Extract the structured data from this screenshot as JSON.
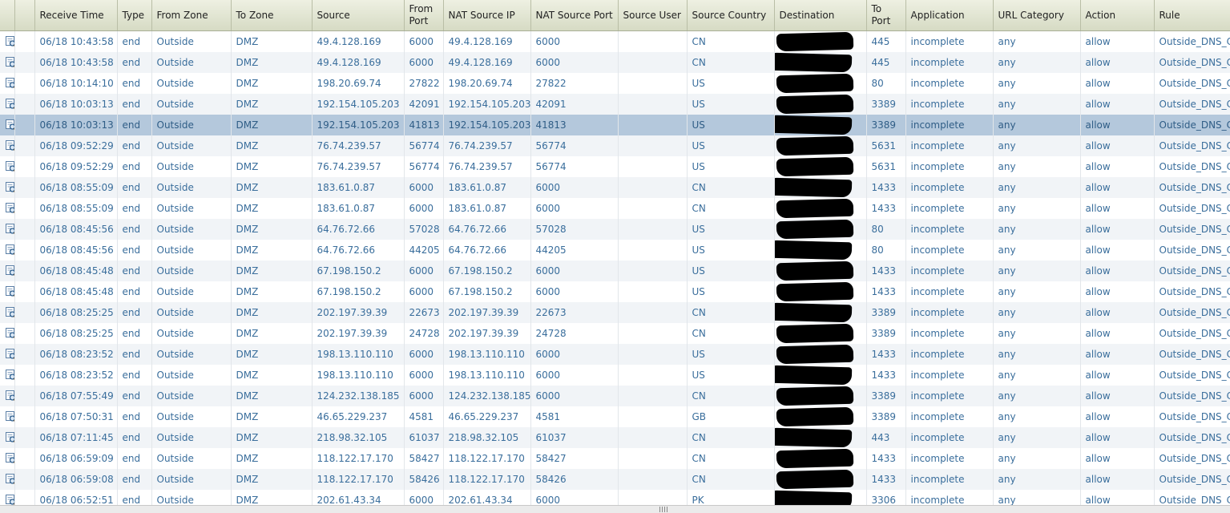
{
  "columns": [
    "",
    "",
    "Receive Time",
    "Type",
    "From Zone",
    "To Zone",
    "Source",
    "From Port",
    "NAT Source IP",
    "NAT Source Port",
    "Source User",
    "Source Country",
    "Destination",
    "To Port",
    "Application",
    "URL Category",
    "Action",
    "Rule"
  ],
  "rows": [
    {
      "time": "06/18 10:43:58",
      "type": "end",
      "from_zone": "Outside",
      "to_zone": "DMZ",
      "source": "49.4.128.169",
      "from_port": "6000",
      "nat_ip": "49.4.128.169",
      "nat_port": "6000",
      "user": "",
      "country": "CN",
      "to_port": "445",
      "app": "incomplete",
      "url": "any",
      "action": "allow",
      "rule": "Outside_DNS_C"
    },
    {
      "time": "06/18 10:43:58",
      "type": "end",
      "from_zone": "Outside",
      "to_zone": "DMZ",
      "source": "49.4.128.169",
      "from_port": "6000",
      "nat_ip": "49.4.128.169",
      "nat_port": "6000",
      "user": "",
      "country": "CN",
      "to_port": "445",
      "app": "incomplete",
      "url": "any",
      "action": "allow",
      "rule": "Outside_DNS_C"
    },
    {
      "time": "06/18 10:14:10",
      "type": "end",
      "from_zone": "Outside",
      "to_zone": "DMZ",
      "source": "198.20.69.74",
      "from_port": "27822",
      "nat_ip": "198.20.69.74",
      "nat_port": "27822",
      "user": "",
      "country": "US",
      "to_port": "80",
      "app": "incomplete",
      "url": "any",
      "action": "allow",
      "rule": "Outside_DNS_C"
    },
    {
      "time": "06/18 10:03:13",
      "type": "end",
      "from_zone": "Outside",
      "to_zone": "DMZ",
      "source": "192.154.105.203",
      "from_port": "42091",
      "nat_ip": "192.154.105.203",
      "nat_port": "42091",
      "user": "",
      "country": "US",
      "to_port": "3389",
      "app": "incomplete",
      "url": "any",
      "action": "allow",
      "rule": "Outside_DNS_C"
    },
    {
      "time": "06/18 10:03:13",
      "type": "end",
      "from_zone": "Outside",
      "to_zone": "DMZ",
      "source": "192.154.105.203",
      "from_port": "41813",
      "nat_ip": "192.154.105.203",
      "nat_port": "41813",
      "user": "",
      "country": "US",
      "to_port": "3389",
      "app": "incomplete",
      "url": "any",
      "action": "allow",
      "rule": "Outside_DNS_C"
    },
    {
      "time": "06/18 09:52:29",
      "type": "end",
      "from_zone": "Outside",
      "to_zone": "DMZ",
      "source": "76.74.239.57",
      "from_port": "56774",
      "nat_ip": "76.74.239.57",
      "nat_port": "56774",
      "user": "",
      "country": "US",
      "to_port": "5631",
      "app": "incomplete",
      "url": "any",
      "action": "allow",
      "rule": "Outside_DNS_C"
    },
    {
      "time": "06/18 09:52:29",
      "type": "end",
      "from_zone": "Outside",
      "to_zone": "DMZ",
      "source": "76.74.239.57",
      "from_port": "56774",
      "nat_ip": "76.74.239.57",
      "nat_port": "56774",
      "user": "",
      "country": "US",
      "to_port": "5631",
      "app": "incomplete",
      "url": "any",
      "action": "allow",
      "rule": "Outside_DNS_C"
    },
    {
      "time": "06/18 08:55:09",
      "type": "end",
      "from_zone": "Outside",
      "to_zone": "DMZ",
      "source": "183.61.0.87",
      "from_port": "6000",
      "nat_ip": "183.61.0.87",
      "nat_port": "6000",
      "user": "",
      "country": "CN",
      "to_port": "1433",
      "app": "incomplete",
      "url": "any",
      "action": "allow",
      "rule": "Outside_DNS_C"
    },
    {
      "time": "06/18 08:55:09",
      "type": "end",
      "from_zone": "Outside",
      "to_zone": "DMZ",
      "source": "183.61.0.87",
      "from_port": "6000",
      "nat_ip": "183.61.0.87",
      "nat_port": "6000",
      "user": "",
      "country": "CN",
      "to_port": "1433",
      "app": "incomplete",
      "url": "any",
      "action": "allow",
      "rule": "Outside_DNS_C"
    },
    {
      "time": "06/18 08:45:56",
      "type": "end",
      "from_zone": "Outside",
      "to_zone": "DMZ",
      "source": "64.76.72.66",
      "from_port": "57028",
      "nat_ip": "64.76.72.66",
      "nat_port": "57028",
      "user": "",
      "country": "US",
      "to_port": "80",
      "app": "incomplete",
      "url": "any",
      "action": "allow",
      "rule": "Outside_DNS_C"
    },
    {
      "time": "06/18 08:45:56",
      "type": "end",
      "from_zone": "Outside",
      "to_zone": "DMZ",
      "source": "64.76.72.66",
      "from_port": "44205",
      "nat_ip": "64.76.72.66",
      "nat_port": "44205",
      "user": "",
      "country": "US",
      "to_port": "80",
      "app": "incomplete",
      "url": "any",
      "action": "allow",
      "rule": "Outside_DNS_C"
    },
    {
      "time": "06/18 08:45:48",
      "type": "end",
      "from_zone": "Outside",
      "to_zone": "DMZ",
      "source": "67.198.150.2",
      "from_port": "6000",
      "nat_ip": "67.198.150.2",
      "nat_port": "6000",
      "user": "",
      "country": "US",
      "to_port": "1433",
      "app": "incomplete",
      "url": "any",
      "action": "allow",
      "rule": "Outside_DNS_C"
    },
    {
      "time": "06/18 08:45:48",
      "type": "end",
      "from_zone": "Outside",
      "to_zone": "DMZ",
      "source": "67.198.150.2",
      "from_port": "6000",
      "nat_ip": "67.198.150.2",
      "nat_port": "6000",
      "user": "",
      "country": "US",
      "to_port": "1433",
      "app": "incomplete",
      "url": "any",
      "action": "allow",
      "rule": "Outside_DNS_C"
    },
    {
      "time": "06/18 08:25:25",
      "type": "end",
      "from_zone": "Outside",
      "to_zone": "DMZ",
      "source": "202.197.39.39",
      "from_port": "22673",
      "nat_ip": "202.197.39.39",
      "nat_port": "22673",
      "user": "",
      "country": "CN",
      "to_port": "3389",
      "app": "incomplete",
      "url": "any",
      "action": "allow",
      "rule": "Outside_DNS_C"
    },
    {
      "time": "06/18 08:25:25",
      "type": "end",
      "from_zone": "Outside",
      "to_zone": "DMZ",
      "source": "202.197.39.39",
      "from_port": "24728",
      "nat_ip": "202.197.39.39",
      "nat_port": "24728",
      "user": "",
      "country": "CN",
      "to_port": "3389",
      "app": "incomplete",
      "url": "any",
      "action": "allow",
      "rule": "Outside_DNS_C"
    },
    {
      "time": "06/18 08:23:52",
      "type": "end",
      "from_zone": "Outside",
      "to_zone": "DMZ",
      "source": "198.13.110.110",
      "from_port": "6000",
      "nat_ip": "198.13.110.110",
      "nat_port": "6000",
      "user": "",
      "country": "US",
      "to_port": "1433",
      "app": "incomplete",
      "url": "any",
      "action": "allow",
      "rule": "Outside_DNS_C"
    },
    {
      "time": "06/18 08:23:52",
      "type": "end",
      "from_zone": "Outside",
      "to_zone": "DMZ",
      "source": "198.13.110.110",
      "from_port": "6000",
      "nat_ip": "198.13.110.110",
      "nat_port": "6000",
      "user": "",
      "country": "US",
      "to_port": "1433",
      "app": "incomplete",
      "url": "any",
      "action": "allow",
      "rule": "Outside_DNS_C"
    },
    {
      "time": "06/18 07:55:49",
      "type": "end",
      "from_zone": "Outside",
      "to_zone": "DMZ",
      "source": "124.232.138.185",
      "from_port": "6000",
      "nat_ip": "124.232.138.185",
      "nat_port": "6000",
      "user": "",
      "country": "CN",
      "to_port": "3389",
      "app": "incomplete",
      "url": "any",
      "action": "allow",
      "rule": "Outside_DNS_C"
    },
    {
      "time": "06/18 07:50:31",
      "type": "end",
      "from_zone": "Outside",
      "to_zone": "DMZ",
      "source": "46.65.229.237",
      "from_port": "4581",
      "nat_ip": "46.65.229.237",
      "nat_port": "4581",
      "user": "",
      "country": "GB",
      "to_port": "3389",
      "app": "incomplete",
      "url": "any",
      "action": "allow",
      "rule": "Outside_DNS_C"
    },
    {
      "time": "06/18 07:11:45",
      "type": "end",
      "from_zone": "Outside",
      "to_zone": "DMZ",
      "source": "218.98.32.105",
      "from_port": "61037",
      "nat_ip": "218.98.32.105",
      "nat_port": "61037",
      "user": "",
      "country": "CN",
      "to_port": "443",
      "app": "incomplete",
      "url": "any",
      "action": "allow",
      "rule": "Outside_DNS_C"
    },
    {
      "time": "06/18 06:59:09",
      "type": "end",
      "from_zone": "Outside",
      "to_zone": "DMZ",
      "source": "118.122.17.170",
      "from_port": "58427",
      "nat_ip": "118.122.17.170",
      "nat_port": "58427",
      "user": "",
      "country": "CN",
      "to_port": "1433",
      "app": "incomplete",
      "url": "any",
      "action": "allow",
      "rule": "Outside_DNS_C"
    },
    {
      "time": "06/18 06:59:08",
      "type": "end",
      "from_zone": "Outside",
      "to_zone": "DMZ",
      "source": "118.122.17.170",
      "from_port": "58426",
      "nat_ip": "118.122.17.170",
      "nat_port": "58426",
      "user": "",
      "country": "CN",
      "to_port": "1433",
      "app": "incomplete",
      "url": "any",
      "action": "allow",
      "rule": "Outside_DNS_C"
    },
    {
      "time": "06/18 06:52:51",
      "type": "end",
      "from_zone": "Outside",
      "to_zone": "DMZ",
      "source": "202.61.43.34",
      "from_port": "6000",
      "nat_ip": "202.61.43.34",
      "nat_port": "6000",
      "user": "",
      "country": "PK",
      "to_port": "3306",
      "app": "incomplete",
      "url": "any",
      "action": "allow",
      "rule": "Outside_DNS_C"
    }
  ],
  "selected_row": 4,
  "icons": {
    "row_detail": "log-detail-magnifier-icon",
    "scroll_grip": "scrollbar-grip-icon"
  },
  "colors": {
    "cell_text": "#3a6e9c",
    "header_bg": "#d6dbc4",
    "row_alt_bg": "#f1f4f7",
    "selected_bg": "#b4c8dc",
    "redaction": "#000000"
  }
}
